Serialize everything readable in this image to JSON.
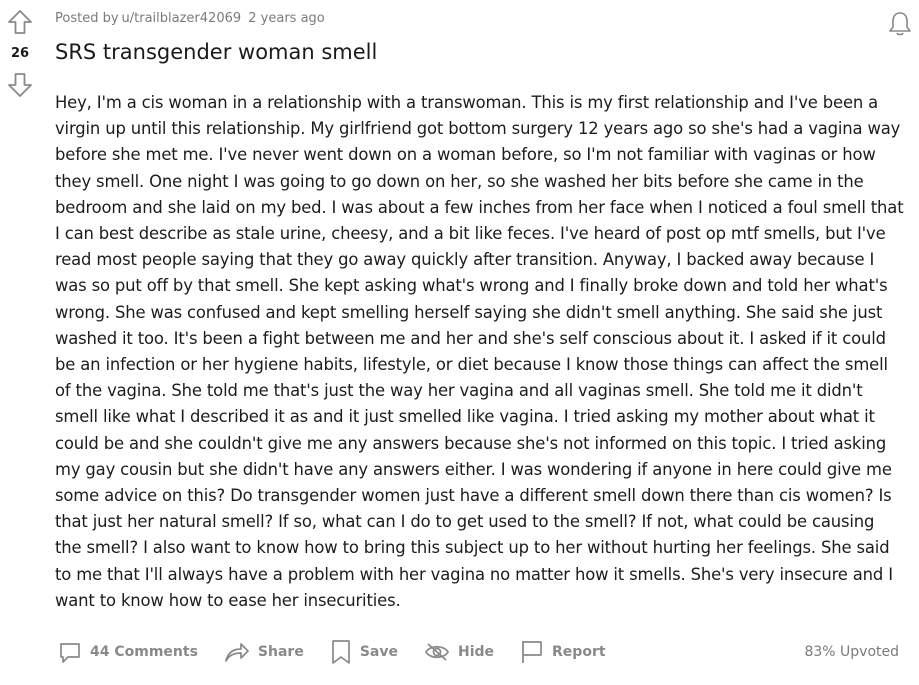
{
  "post": {
    "score": "26",
    "meta_prefix": "Posted by",
    "author": "u/trailblazer42069",
    "time_ago": "2 years ago",
    "title": "SRS transgender woman smell",
    "body": "Hey, I'm a cis woman in a relationship with a transwoman. This is my first relationship and I've been a virgin up until this relationship. My girlfriend got bottom surgery 12 years ago so she's had a vagina way before she met me. I've never went down on a woman before, so I'm not familiar with vaginas or how they smell. One night I was going to go down on her, so she washed her bits before she came in the bedroom and she laid on my bed. I was about a few inches from her face when I noticed a foul smell that I can best describe as stale urine, cheesy, and a bit like feces. I've heard of post op mtf smells, but I've read most people saying that they go away quickly after transition. Anyway, I backed away because I was so put off by that smell. She kept asking what's wrong and I finally broke down and told her what's wrong. She was confused and kept smelling herself saying she didn't smell anything. She said she just washed it too. It's been a fight between me and her and she's self conscious about it. I asked if it could be an infection or her hygiene habits, lifestyle, or diet because I know those things can affect the smell of the vagina. She told me that's just the way her vagina and all vaginas smell. She told me it didn't smell like what I described it as and it just smelled like vagina. I tried asking my mother about what it could be and she couldn't give me any answers because she's not informed on this topic. I tried asking my gay cousin but she didn't have any answers either. I was wondering if anyone in here could give me some advice on this? Do transgender women just have a different smell down there than cis women? Is that just her natural smell? If so, what can I do to get used to the smell? If not, what could be causing the smell? I also want to know how to bring this subject up to her without hurting her feelings. She said to me that I'll always have a problem with her vagina no matter how it smells. She's very insecure and I want to know how to ease her insecurities."
  },
  "actions": {
    "comments": "44 Comments",
    "share": "Share",
    "save": "Save",
    "hide": "Hide",
    "report": "Report",
    "upvoted": "83% Upvoted"
  },
  "icons": {
    "upvote": "upvote-arrow-icon",
    "downvote": "downvote-arrow-icon",
    "notify": "bell-icon",
    "comments": "comment-bubble-icon",
    "share": "share-arrow-icon",
    "save": "bookmark-icon",
    "hide": "eye-slash-icon",
    "report": "flag-icon"
  },
  "colors": {
    "icon_gray": "#878a8c",
    "meta_gray": "#787c7e",
    "text": "#1c1c1c"
  }
}
